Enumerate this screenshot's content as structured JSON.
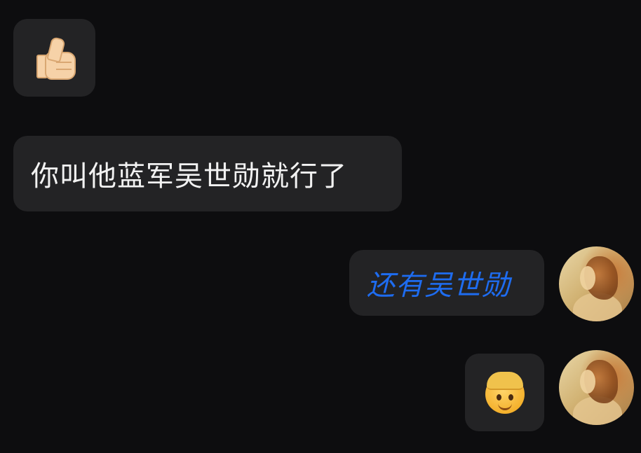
{
  "messages": [
    {
      "side": "left",
      "type": "emoji",
      "icon": "thumbs-up-icon"
    },
    {
      "side": "left",
      "type": "text",
      "text": "你叫他蓝军吴世勋就行了"
    },
    {
      "side": "right",
      "type": "link-text",
      "text": "还有吴世勋",
      "color": "#1e6cf0"
    },
    {
      "side": "right",
      "type": "emoji",
      "icon": "boy-face-icon"
    }
  ],
  "colors": {
    "background": "#0d0d0f",
    "bubble": "#232325",
    "text": "#f2f2f2",
    "link": "#1e6cf0"
  }
}
